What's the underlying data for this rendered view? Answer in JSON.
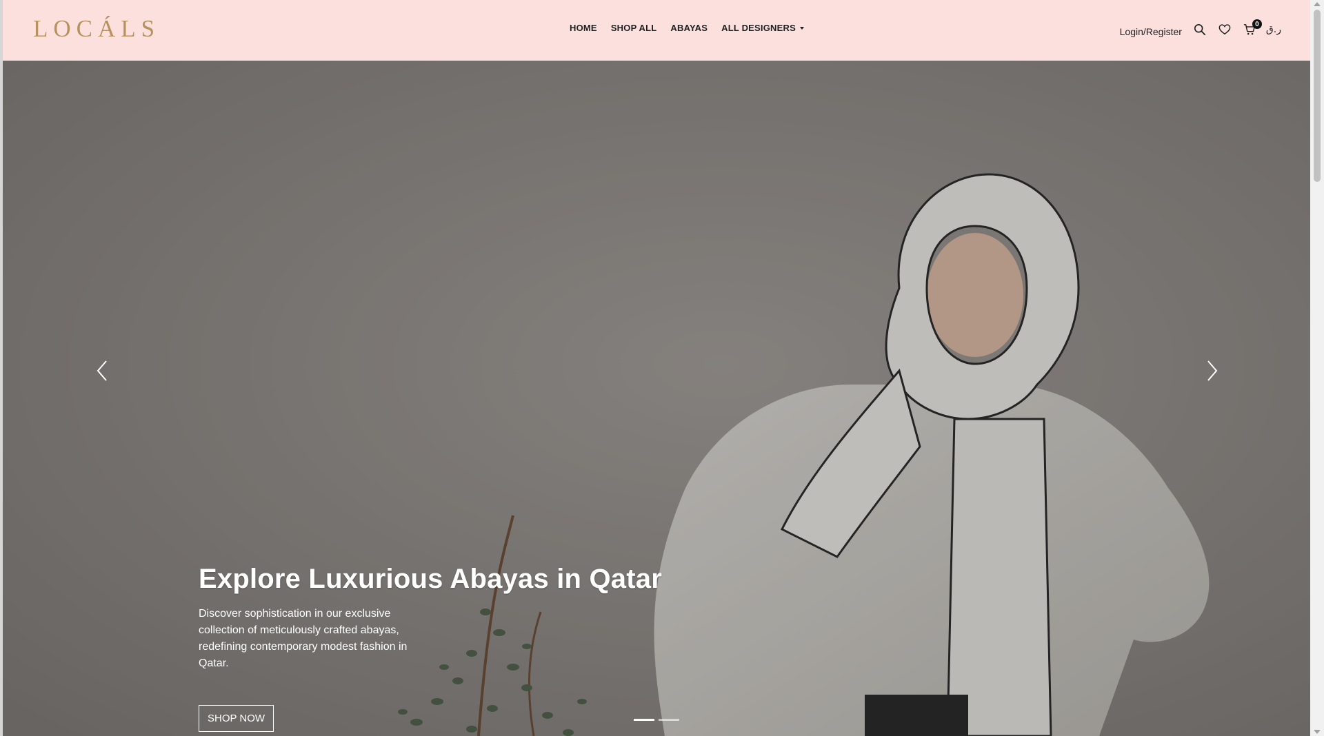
{
  "brand": {
    "logo": "LOCÁLS"
  },
  "nav": {
    "items": [
      {
        "label": "HOME"
      },
      {
        "label": "SHOP ALL"
      },
      {
        "label": "ABAYAS"
      },
      {
        "label": "ALL DESIGNERS"
      }
    ]
  },
  "header": {
    "login_label": "Login/Register",
    "cart_count": "0",
    "language_label": "ر.ق"
  },
  "icons": {
    "search": "search-icon",
    "wishlist": "heart-icon",
    "cart": "cart-icon",
    "prev": "chevron-left-icon",
    "next": "chevron-right-icon",
    "dropdown": "caret-down-icon"
  },
  "hero": {
    "title": "Explore Luxurious Abayas in Qatar",
    "description": "Discover sophistication in our exclusive collection of meticulously crafted abayas, redefining contemporary modest fashion in Qatar.",
    "cta_label": "SHOP NOW",
    "slide_count": 2,
    "active_slide": 1
  },
  "colors": {
    "header_bg": "#fbe0de",
    "logo": "#b7925e",
    "hero_bg": "#8d8a87",
    "text_dark": "#1f1f1f",
    "text_light": "#ffffff"
  }
}
